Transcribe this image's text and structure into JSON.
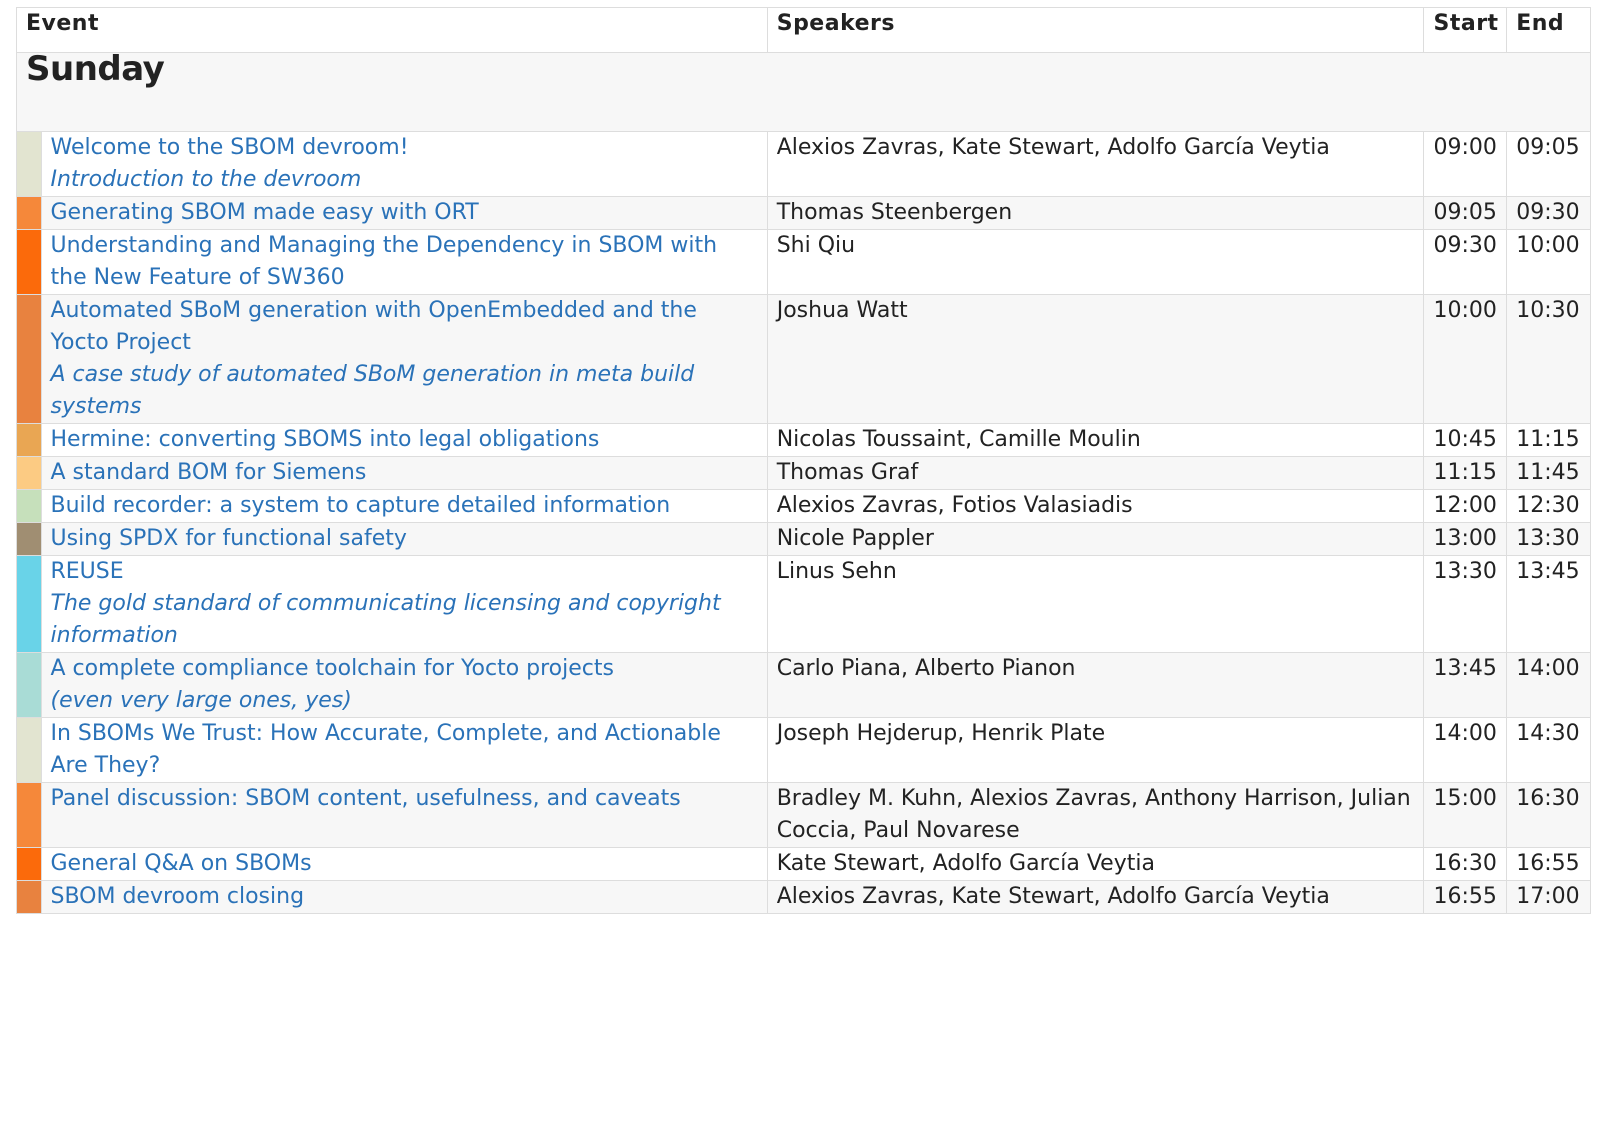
{
  "header": {
    "event": "Event",
    "speakers": "Speakers",
    "start": "Start",
    "end": "End"
  },
  "day": "Sunday",
  "rows": [
    {
      "title": "Welcome to the SBOM devroom!",
      "subtitle": "Introduction to the devroom",
      "speakers": "Alexios Zavras, Kate Stewart, Adolfo García Veytia",
      "start": "09:00",
      "end": "09:05",
      "color": "#e2e4d0"
    },
    {
      "title": "Generating SBOM made easy with ORT",
      "subtitle": "",
      "speakers": "Thomas Steenbergen",
      "start": "09:05",
      "end": "09:30",
      "color": "#f5883a"
    },
    {
      "title": "Understanding and Managing the Dependency in SBOM with the New Feature of SW360",
      "subtitle": "",
      "speakers": "Shi Qiu",
      "start": "09:30",
      "end": "10:00",
      "color": "#fb6a0b"
    },
    {
      "title": "Automated SBoM generation with OpenEmbedded and the Yocto Project",
      "subtitle": "A case study of automated SBoM generation in meta build systems",
      "speakers": "Joshua Watt",
      "start": "10:00",
      "end": "10:30",
      "color": "#e8823f"
    },
    {
      "title": "Hermine: converting SBOMS into legal obligations",
      "subtitle": "",
      "speakers": "Nicolas Toussaint, Camille Moulin",
      "start": "10:45",
      "end": "11:15",
      "color": "#e9a653"
    },
    {
      "title": "A standard BOM for Siemens",
      "subtitle": "",
      "speakers": "Thomas Graf",
      "start": "11:15",
      "end": "11:45",
      "color": "#fccb83"
    },
    {
      "title": "Build recorder: a system to capture detailed information",
      "subtitle": "",
      "speakers": "Alexios Zavras, Fotios Valasiadis",
      "start": "12:00",
      "end": "12:30",
      "color": "#c6e0bb"
    },
    {
      "title": "Using SPDX for functional safety",
      "subtitle": "",
      "speakers": "Nicole Pappler",
      "start": "13:00",
      "end": "13:30",
      "color": "#a08e72"
    },
    {
      "title": "REUSE",
      "subtitle": "The gold standard of communicating licensing and copyright information",
      "speakers": "Linus Sehn",
      "start": "13:30",
      "end": "13:45",
      "color": "#69d3e8"
    },
    {
      "title": "A complete compliance toolchain for Yocto projects",
      "subtitle": "(even very large ones, yes)",
      "speakers": "Carlo Piana, Alberto Pianon",
      "start": "13:45",
      "end": "14:00",
      "color": "#a9dcd6"
    },
    {
      "title": "In SBOMs We Trust: How Accurate, Complete, and Actionable Are They?",
      "subtitle": "",
      "speakers": "Joseph Hejderup, Henrik Plate",
      "start": "14:00",
      "end": "14:30",
      "color": "#e2e4d0"
    },
    {
      "title": "Panel discussion: SBOM content, usefulness, and caveats",
      "subtitle": "",
      "speakers": "Bradley M. Kuhn, Alexios Zavras, Anthony Harrison, Julian Coccia, Paul Novarese",
      "start": "15:00",
      "end": "16:30",
      "color": "#f5883a"
    },
    {
      "title": "General Q&A on SBOMs",
      "subtitle": "",
      "speakers": "Kate Stewart, Adolfo García Veytia",
      "start": "16:30",
      "end": "16:55",
      "color": "#fb6a0b"
    },
    {
      "title": "SBOM devroom closing",
      "subtitle": "",
      "speakers": "Alexios Zavras, Kate Stewart, Adolfo García Veytia",
      "start": "16:55",
      "end": "17:00",
      "color": "#e8823f"
    }
  ]
}
